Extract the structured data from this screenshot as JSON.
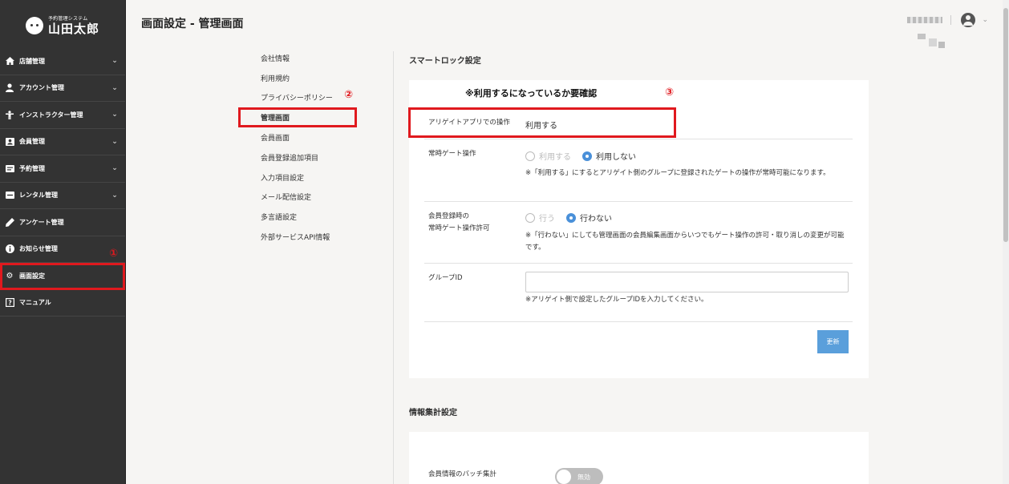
{
  "logo": {
    "sub": "予約管理システム",
    "main": "山田太郎"
  },
  "sidebar": {
    "items": [
      {
        "label": "店舗管理",
        "icon": "home-icon"
      },
      {
        "label": "アカウント管理",
        "icon": "person-icon"
      },
      {
        "label": "インストラクター管理",
        "icon": "instructor-icon"
      },
      {
        "label": "会員管理",
        "icon": "member-card-icon"
      },
      {
        "label": "予約管理",
        "icon": "reservation-icon"
      },
      {
        "label": "レンタル管理",
        "icon": "rental-icon"
      },
      {
        "label": "アンケート管理",
        "icon": "pen-icon"
      },
      {
        "label": "お知らせ管理",
        "icon": "info-icon"
      },
      {
        "label": "画面設定",
        "icon": "gear-icon",
        "active": true
      },
      {
        "label": "マニュアル",
        "icon": "help-icon"
      }
    ]
  },
  "header": {
    "title": "画面設定 - 管理画面"
  },
  "submenu": {
    "items": [
      "会社情報",
      "利用規約",
      "プライバシーポリシー",
      "管理画面",
      "会員画面",
      "会員登録追加項目",
      "入力項目設定",
      "メール配信設定",
      "多言語設定",
      "外部サービスAPI情報"
    ],
    "active_index": 3
  },
  "annotations": {
    "one": "①",
    "two": "②",
    "three": "③"
  },
  "smartlock": {
    "title": "スマートロック設定",
    "warning": "※利用するになっているか要確認",
    "app_operation": {
      "label": "アリゲイトアプリでの操作",
      "value": "利用する"
    },
    "always_gate": {
      "label": "常時ゲート操作",
      "options": [
        "利用する",
        "利用しない"
      ],
      "selected": "利用しない",
      "note": "※「利用する」にするとアリゲイト側のグループに登録されたゲートの操作が常時可能になります。"
    },
    "register_gate": {
      "label_line1": "会員登録時の",
      "label_line2": "常時ゲート操作許可",
      "options": [
        "行う",
        "行わない"
      ],
      "selected": "行わない",
      "note": "※「行わない」にしても管理画面の会員編集画面からいつでもゲート操作の許可・取り消しの変更が可能です。"
    },
    "group_id": {
      "label": "グループID",
      "value": "",
      "note": "※アリゲイト側で設定したグループIDを入力してください。"
    },
    "update_label": "更新"
  },
  "stats": {
    "title": "情報集計設定",
    "batch": {
      "label": "会員情報のバッチ集計",
      "toggle_label": "無効"
    }
  },
  "colors": {
    "accent": "#4a90d9",
    "annotation": "#e0191e",
    "sidebar": "#333333"
  }
}
